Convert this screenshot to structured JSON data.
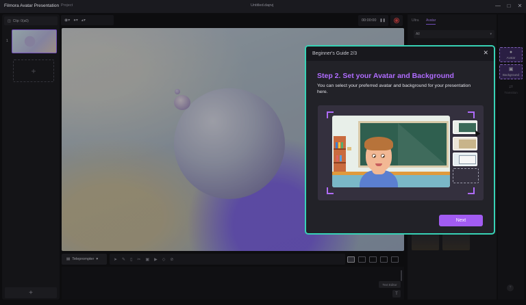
{
  "titlebar": {
    "app_title": "Filmora Avatar Presentation",
    "project_tab": "Project",
    "file_name": "Untitled.dapvj",
    "minimize_icon": "minimize-icon",
    "maximize_icon": "maximize-icon",
    "close_icon": "close-icon"
  },
  "left_panel": {
    "clip_label": "Clip: 0(a0)",
    "slides": [
      {
        "number": "1"
      }
    ],
    "add_symbol": "+"
  },
  "toolbar": {
    "timer": "00:00:00",
    "pause_symbol": "❚❚"
  },
  "bottom_toolbar": {
    "teleprompter_label": "Teleprompter",
    "text_editor_label": "Text Editor",
    "text_editor_symbol": "T"
  },
  "right_panel": {
    "tabs": [
      {
        "label": "Ultra"
      },
      {
        "label": "Avatar"
      }
    ],
    "active_tab": "Avatar",
    "filter_value": "All",
    "side_items": [
      {
        "label": "Avatar",
        "icon": "person-icon"
      },
      {
        "label": "Background",
        "icon": "image-icon"
      },
      {
        "label": "Transition",
        "icon": "transition-icon"
      }
    ],
    "help_symbol": "?"
  },
  "dialog": {
    "header_title": "Beginner's Guide 2/3",
    "close_symbol": "✕",
    "step_title": "Step 2. Set your Avatar and Background",
    "description": "You can select your preferred avatar and background for your presentation here.",
    "next_label": "Next"
  },
  "colors": {
    "accent": "#9b6bff",
    "dialog_border": "#37d3b6",
    "next_button": "#a25cf2",
    "record": "#e24848"
  }
}
